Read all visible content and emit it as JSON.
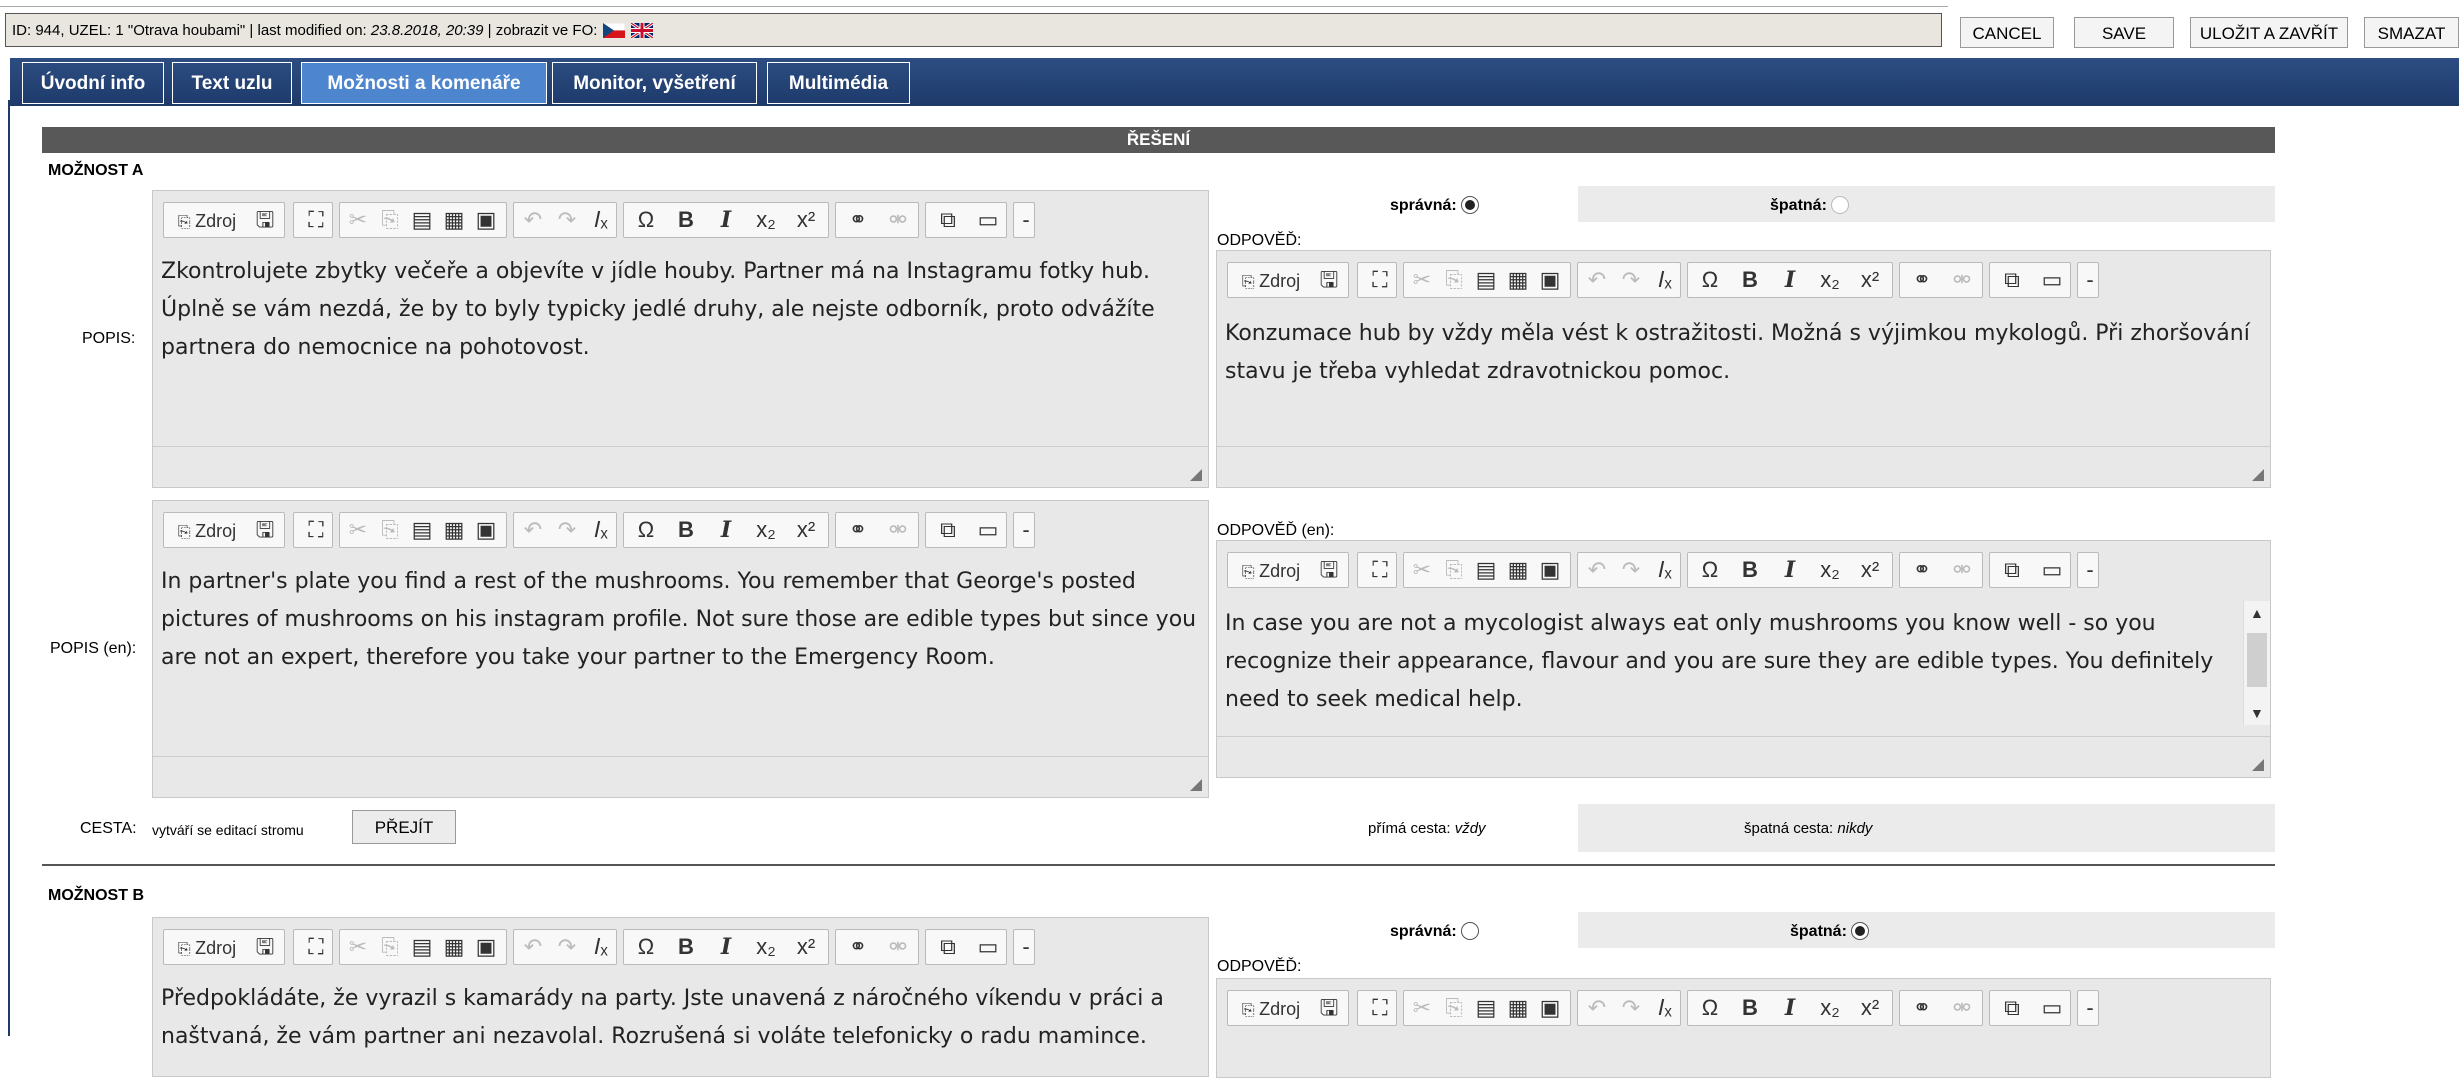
{
  "header": {
    "info_prefix": "ID: 944, UZEL: 1 \"Otrava houbami\" | last modified on: ",
    "modified": "23.8.2018, 20:39",
    "info_suffix": " | zobrazit ve FO:",
    "cancel": "CANCEL",
    "save": "SAVE",
    "save_close": "ULOŽIT A ZAVŘÍT",
    "delete": "SMAZAT"
  },
  "tabs": [
    "Úvodní info",
    "Text uzlu",
    "Možnosti a komenáře",
    "Monitor, vyšetření",
    "Multimédia"
  ],
  "section_title": "ŘEŠENÍ",
  "toolbar": {
    "source_label": "Zdroj",
    "bold": "B",
    "italic": "I"
  },
  "option_a": {
    "title": "MOŽNOST A",
    "popis_label": "POPIS:",
    "popis_en_label": "POPIS (en):",
    "popis": "Zkontrolujete zbytky večeře a objevíte v jídle houby. Partner má na Instagramu fotky hub. Úplně se vám nezdá, že by to byly typicky jedlé druhy, ale nejste odborník, proto odvážíte partnera do nemocnice na pohotovost.",
    "popis_en": "In partner's plate you find a rest of the mushrooms. You remember that George's posted pictures of mushrooms on his instagram profile. Not sure those are edible types but since you are not an expert, therefore you take your partner to the Emergency Room.",
    "spravna_label": "správná:",
    "spatna_label": "špatná:",
    "spravna_checked": true,
    "odpoved_label": "ODPOVĚĎ:",
    "odpoved": "Konzumace hub by vždy měla vést k ostražitosti. Možná s výjimkou mykologů. Při zhoršování stavu je třeba vyhledat zdravotnickou pomoc.",
    "odpoved_en_label": "ODPOVĚĎ (en):",
    "odpoved_en": "In case you are not a mycologist always eat only mushrooms you know well - so you recognize their appearance, flavour and you are sure they are edible types. You definitely need to seek medical help.",
    "cesta_label": "CESTA:",
    "cesta_text": "vytváří se editací stromu",
    "prejit": "PŘEJÍT",
    "prima_label": "přímá cesta:",
    "prima_value": "vždy",
    "spatna_cesta_label": "špatná cesta:",
    "spatna_cesta_value": "nikdy"
  },
  "option_b": {
    "title": "MOŽNOST B",
    "popis": "Předpokládáte, že vyrazil s kamarády na party. Jste unavená z náročného víkendu v práci a naštvaná, že vám partner ani nezavolal. Rozrušená si voláte telefonicky o radu mamince.",
    "spravna_label": "správná:",
    "spatna_label": "špatná:",
    "spravna_checked": false,
    "odpoved_label": "ODPOVĚĎ:"
  }
}
